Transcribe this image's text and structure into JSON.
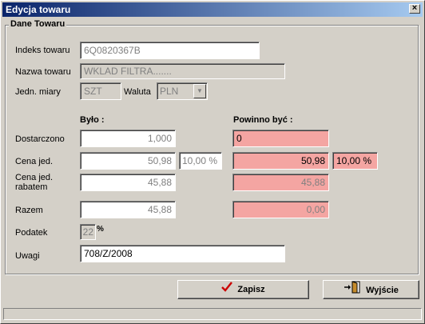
{
  "window": {
    "title": "Edycja towaru",
    "close_glyph": "×"
  },
  "group": {
    "title": "Dane Towaru"
  },
  "fields": {
    "indeks_label": "Indeks towaru",
    "indeks_value": "6Q0820367B",
    "nazwa_label": "Nazwa towaru",
    "nazwa_value": "WKLAD FILTRA.......",
    "jedn_label": "Jedn. miary",
    "jedn_value": "SZT",
    "waluta_label": "Waluta",
    "waluta_value": "PLN",
    "dropdown_icon": "triangle-down-icon"
  },
  "columns": {
    "bylo": "Było :",
    "powinno": "Powinno być :"
  },
  "rows": {
    "dostarczono_label": "Dostarczono",
    "dostarczono_bylo": "1,000",
    "dostarczono_powinno": "0",
    "cena_label": "Cena jed.",
    "cena_bylo": "50,98",
    "cena_bylo_pct": "10,00 %",
    "cena_powinno": "50,98",
    "cena_powinno_pct": "10,00 %",
    "cena_rabat_label_1": "Cena jed.",
    "cena_rabat_label_2": "rabatem",
    "cena_rabat_bylo": "45,88",
    "cena_rabat_powinno": "45,88",
    "razem_label": "Razem",
    "razem_bylo": "45,88",
    "razem_powinno": "0,00",
    "podatek_label": "Podatek",
    "podatek_value": "22",
    "podatek_unit": "%",
    "uwagi_label": "Uwagi",
    "uwagi_value": "708/Z/2008"
  },
  "buttons": {
    "zapisz": "Zapisz",
    "wyjscie": "Wyjście"
  },
  "colors": {
    "highlight": "#f4a5a2",
    "check": "#cc0000"
  }
}
